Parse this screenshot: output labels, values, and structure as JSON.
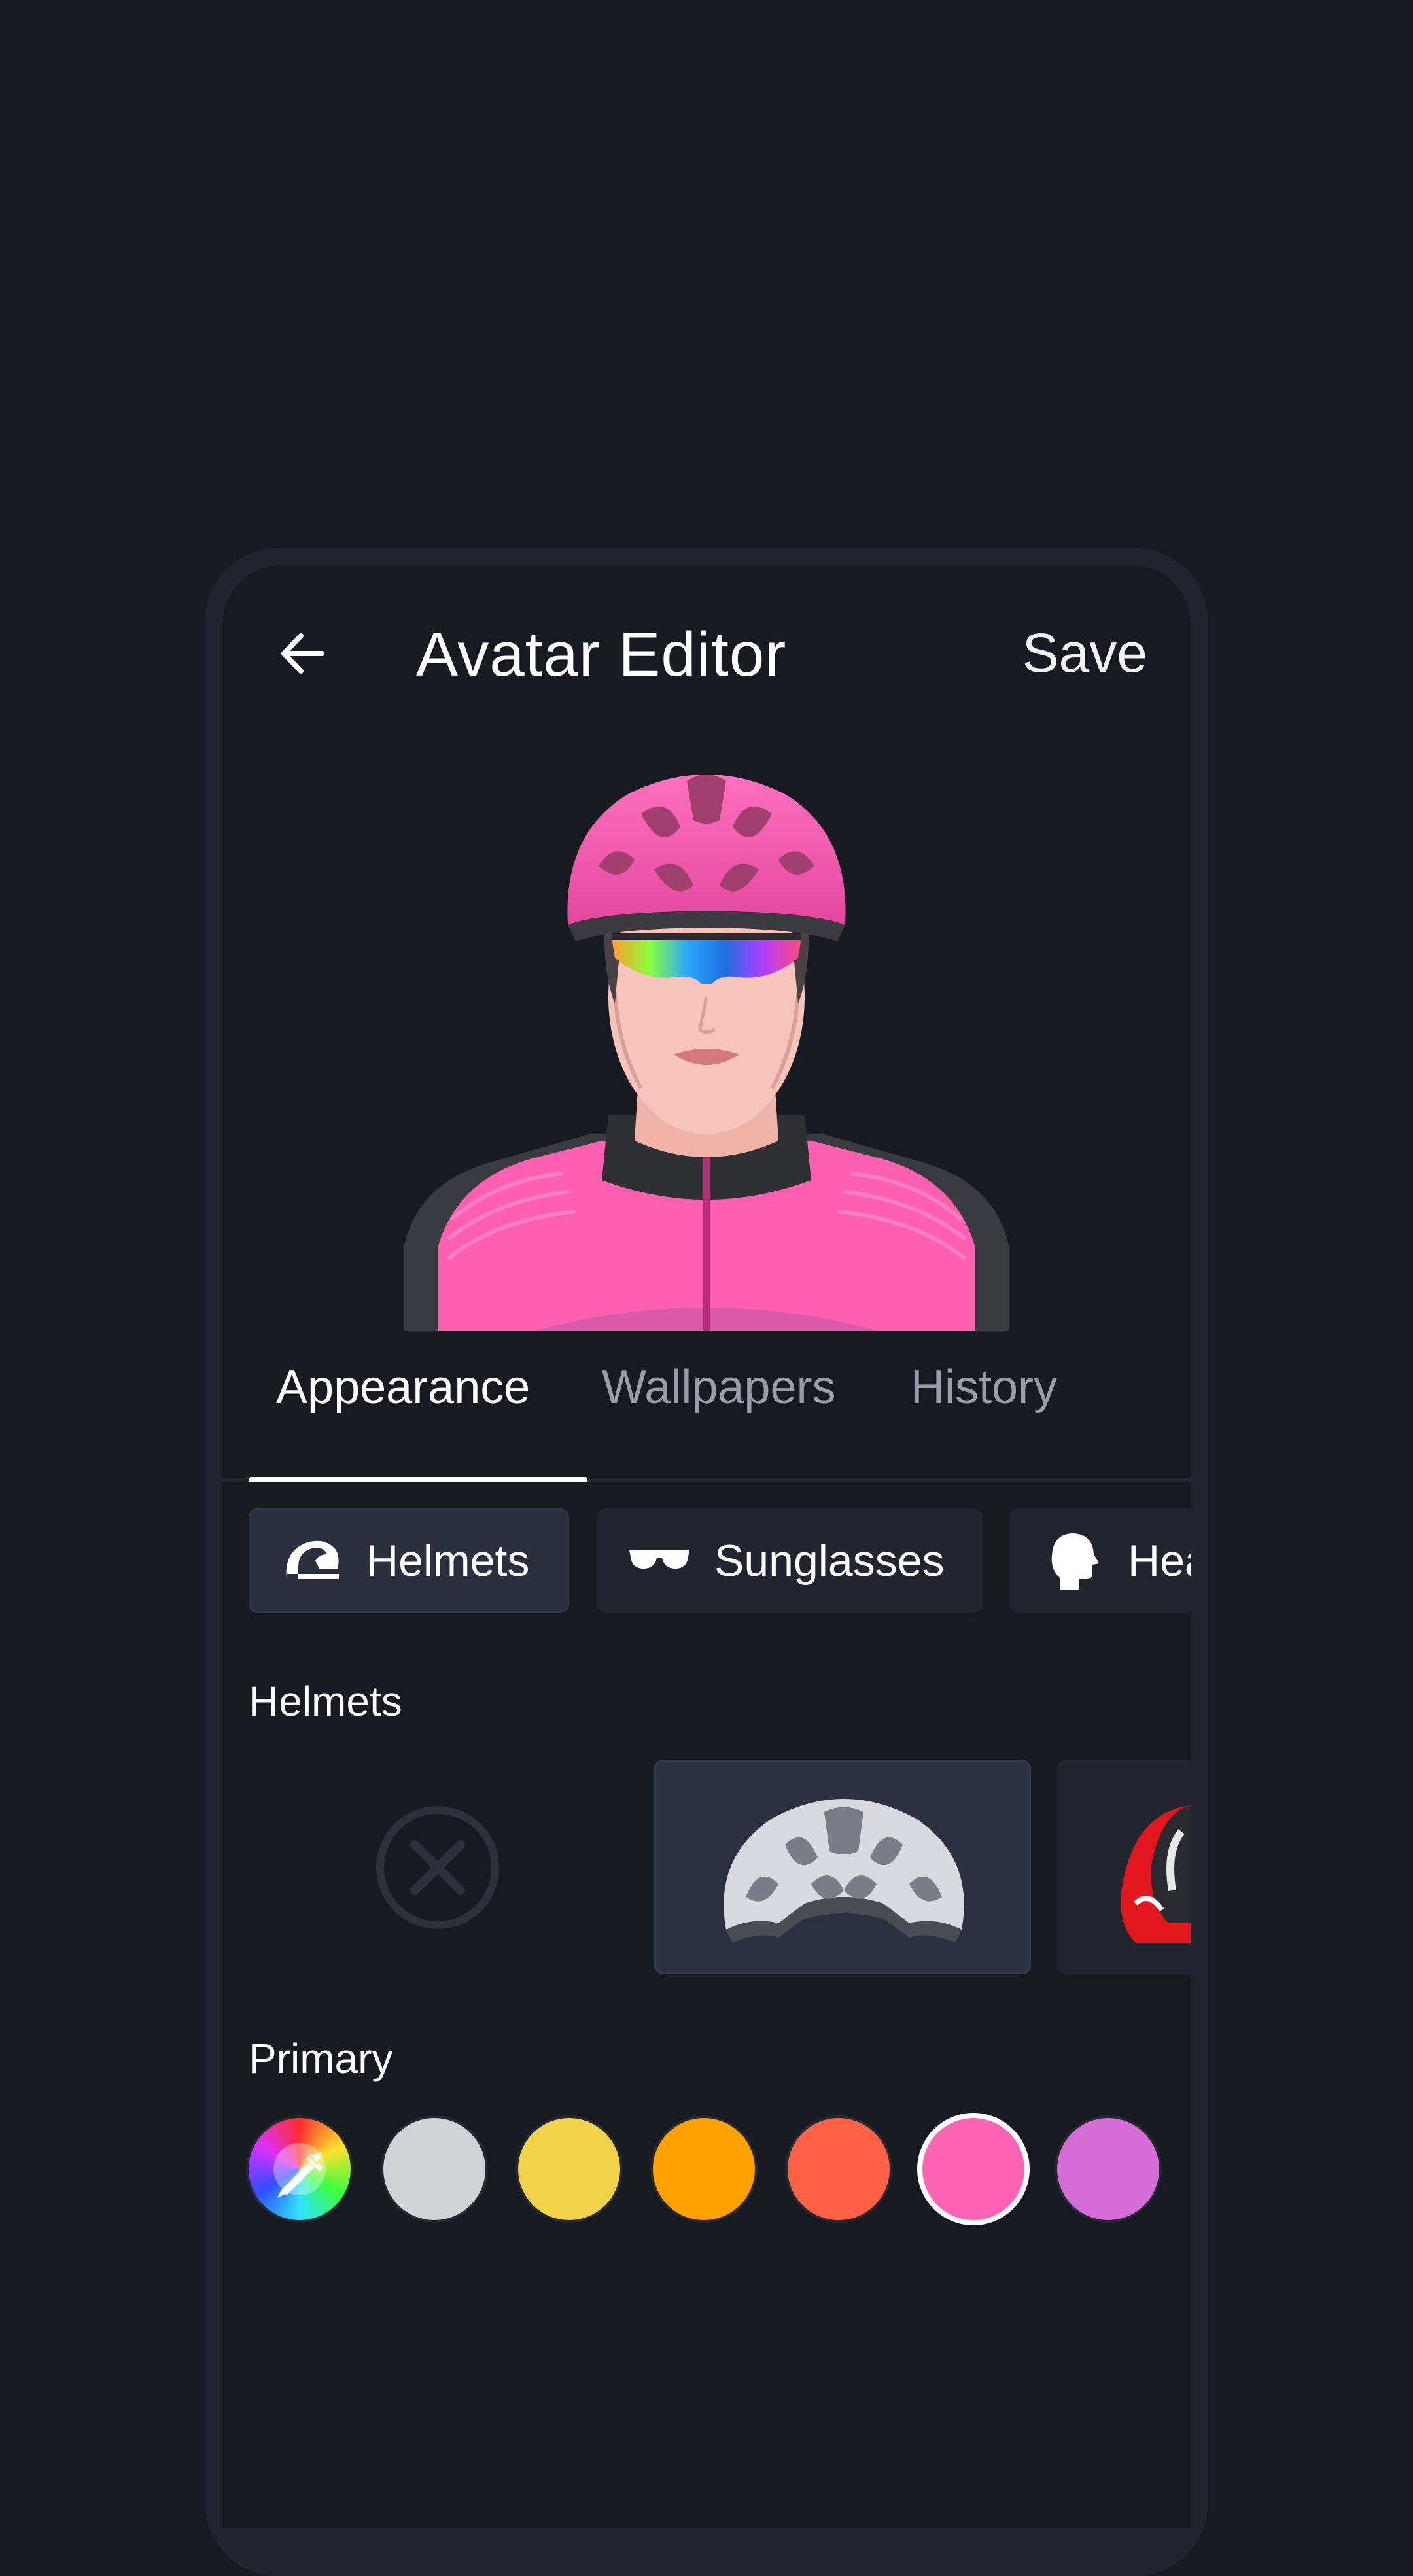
{
  "header": {
    "title": "Avatar Editor",
    "save_label": "Save"
  },
  "tabs": [
    {
      "label": "Appearance",
      "active": true
    },
    {
      "label": "Wallpapers",
      "active": false
    },
    {
      "label": "History",
      "active": false
    }
  ],
  "categories": [
    {
      "label": "Helmets",
      "icon": "helmet-icon",
      "active": true
    },
    {
      "label": "Sunglasses",
      "icon": "sunglasses-icon",
      "active": false
    },
    {
      "label": "Hea",
      "icon": "head-icon",
      "active": false
    }
  ],
  "sections": {
    "items_title": "Helmets",
    "color_title": "Primary"
  },
  "items": [
    {
      "name": "none",
      "icon": "close-circle-icon"
    },
    {
      "name": "white-helmet",
      "selected": true
    },
    {
      "name": "red-black-helmet"
    }
  ],
  "colors": {
    "picker": "color-picker-icon",
    "swatches": [
      "#d1d3d6",
      "#f2d44a",
      "#ffa200",
      "#ff6146",
      "#ff64b4",
      "#d66cd6"
    ],
    "selected": "#ff64b4",
    "accent": "#ff64b4",
    "background": "#181a22"
  }
}
